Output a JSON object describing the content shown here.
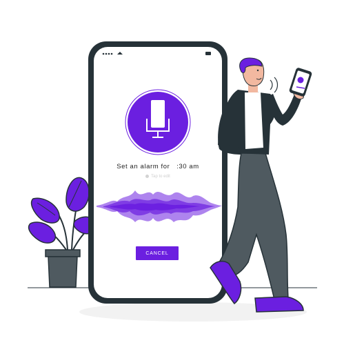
{
  "voice_assistant": {
    "prompt_prefix": "Set an alarm for",
    "prompt_time": ":30 am",
    "hint": "Tap to edit",
    "cancel_label": "CANCEL"
  },
  "colors": {
    "accent": "#6b1fe0",
    "phone_body": "#263238",
    "screen": "#ffffff",
    "pants": "#4f5a60",
    "shoes": "#6b1fe0"
  },
  "icons": [
    "microphone-icon",
    "sound-waves-icon",
    "phone-device",
    "plant-illustration",
    "person-illustration"
  ]
}
